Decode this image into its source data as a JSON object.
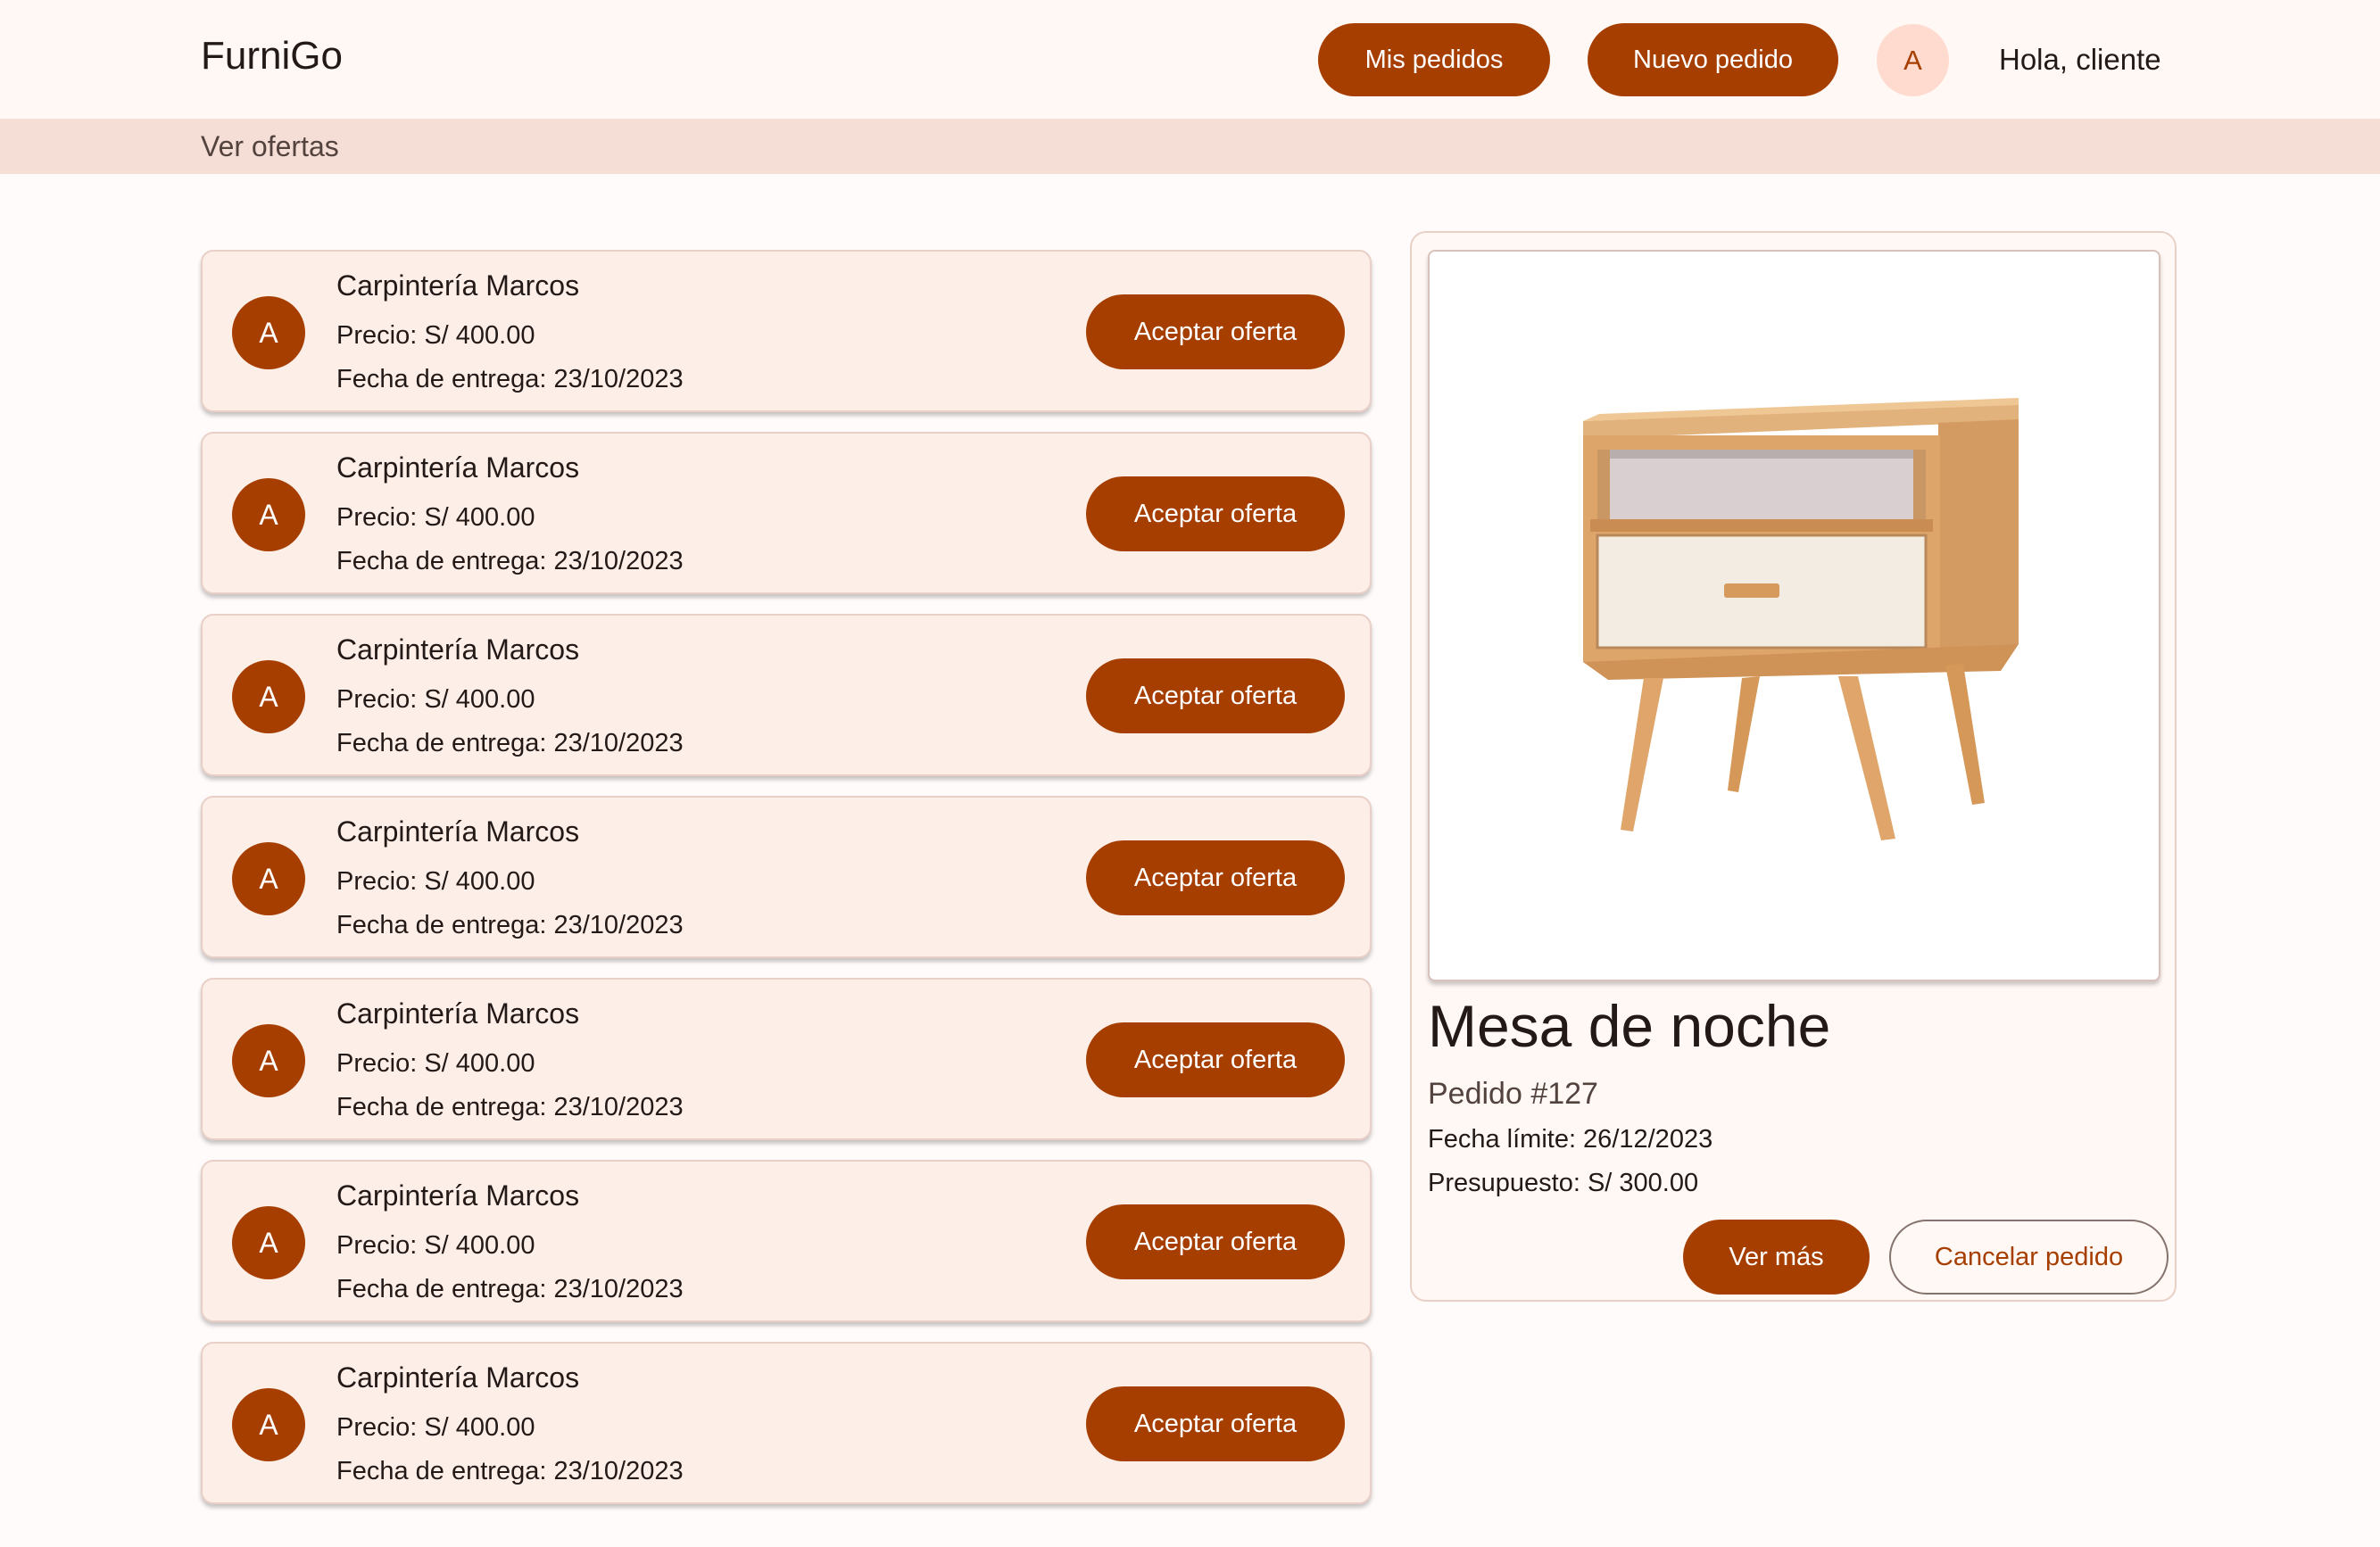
{
  "header": {
    "brand": "FurniGo",
    "my_orders_label": "Mis pedidos",
    "new_order_label": "Nuevo pedido",
    "avatar_initial": "A",
    "greeting": "Hola, cliente"
  },
  "page": {
    "title": "Ver ofertas"
  },
  "offers": [
    {
      "avatar": "A",
      "name": "Carpintería Marcos",
      "price": "Precio: S/ 400.00",
      "delivery": "Fecha de entrega: 23/10/2023",
      "action": "Aceptar oferta"
    },
    {
      "avatar": "A",
      "name": "Carpintería Marcos",
      "price": "Precio: S/ 400.00",
      "delivery": "Fecha de entrega: 23/10/2023",
      "action": "Aceptar oferta"
    },
    {
      "avatar": "A",
      "name": "Carpintería Marcos",
      "price": "Precio: S/ 400.00",
      "delivery": "Fecha de entrega: 23/10/2023",
      "action": "Aceptar oferta"
    },
    {
      "avatar": "A",
      "name": "Carpintería Marcos",
      "price": "Precio: S/ 400.00",
      "delivery": "Fecha de entrega: 23/10/2023",
      "action": "Aceptar oferta"
    },
    {
      "avatar": "A",
      "name": "Carpintería Marcos",
      "price": "Precio: S/ 400.00",
      "delivery": "Fecha de entrega: 23/10/2023",
      "action": "Aceptar oferta"
    },
    {
      "avatar": "A",
      "name": "Carpintería Marcos",
      "price": "Precio: S/ 400.00",
      "delivery": "Fecha de entrega: 23/10/2023",
      "action": "Aceptar oferta"
    },
    {
      "avatar": "A",
      "name": "Carpintería Marcos",
      "price": "Precio: S/ 400.00",
      "delivery": "Fecha de entrega: 23/10/2023",
      "action": "Aceptar oferta"
    }
  ],
  "order": {
    "title": "Mesa de noche",
    "number": "Pedido #127",
    "deadline": "Fecha límite: 26/12/2023",
    "budget": "Presupuesto: S/ 300.00",
    "more_label": "Ver más",
    "cancel_label": "Cancelar pedido"
  },
  "colors": {
    "primary": "#a63e00",
    "background": "#fffbfa",
    "card": "#fdeee8",
    "subbar": "#f5ded6",
    "avatar_light": "#ffdbcf"
  }
}
